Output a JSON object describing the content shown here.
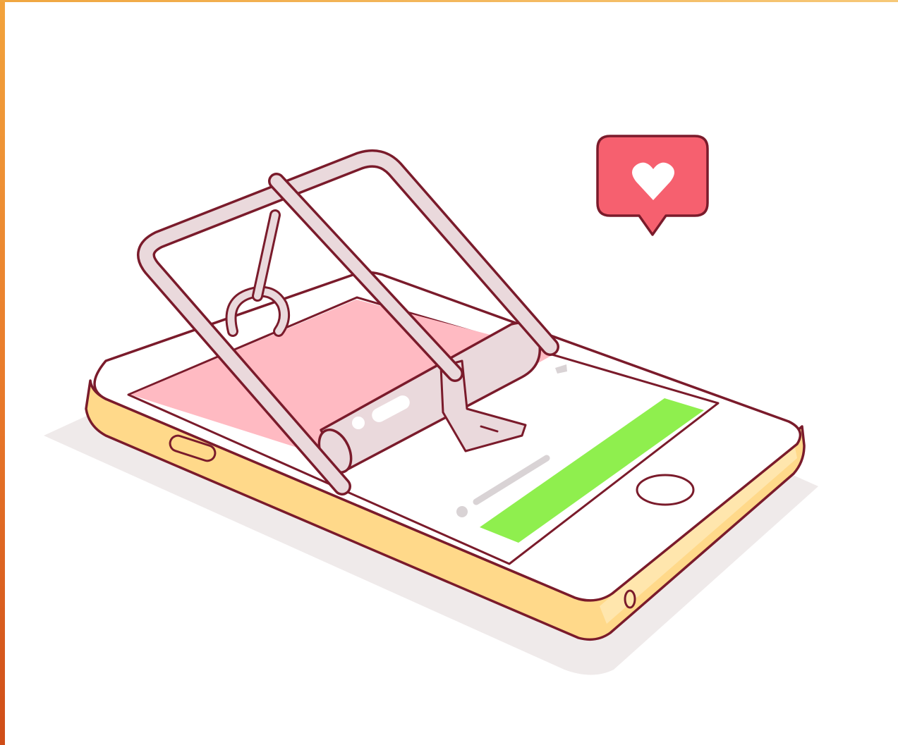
{
  "scene": {
    "subject": "phone-mousetrap-illustration",
    "icons": [
      "heart-icon",
      "speech-bubble-icon",
      "home-button-icon",
      "speaker-slot-icon",
      "mousetrap-icon"
    ],
    "colors": {
      "outline": "#7a1b2b",
      "phone_body": "#ffd98a",
      "phone_body_shade": "#f7c66a",
      "screen": "#ffffff",
      "screen_highlight": "#ffbac2",
      "green_bar": "#8fef4e",
      "metal": "#ead9dc",
      "notification_red": "#f6606f",
      "shadow": "#eeeaea",
      "frame_edge": "#e8782a"
    }
  }
}
